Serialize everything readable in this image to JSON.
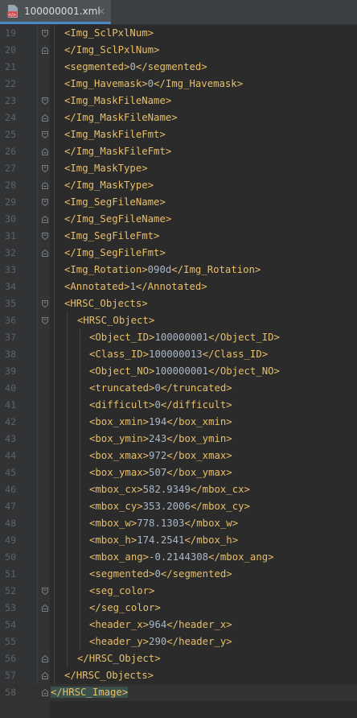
{
  "tab": {
    "filename": "100000001.xml",
    "close_glyph": "×",
    "icon": "xml-file-icon"
  },
  "lines": [
    {
      "no": "19",
      "indent": 1,
      "parts": [
        {
          "t": "<Img_SclPxlNum>",
          "k": "tag"
        }
      ],
      "fold": "open"
    },
    {
      "no": "20",
      "indent": 1,
      "parts": [
        {
          "t": "</Img_SclPxlNum>",
          "k": "tag"
        }
      ],
      "fold": "close"
    },
    {
      "no": "21",
      "indent": 1,
      "parts": [
        {
          "t": "<segmented>",
          "k": "tag"
        },
        {
          "t": "0",
          "k": "text"
        },
        {
          "t": "</segmented>",
          "k": "tag"
        }
      ]
    },
    {
      "no": "22",
      "indent": 1,
      "parts": [
        {
          "t": "<Img_Havemask>",
          "k": "tag"
        },
        {
          "t": "0",
          "k": "text"
        },
        {
          "t": "</Img_Havemask>",
          "k": "tag"
        }
      ]
    },
    {
      "no": "23",
      "indent": 1,
      "parts": [
        {
          "t": "<Img_MaskFileName>",
          "k": "tag"
        }
      ],
      "fold": "open"
    },
    {
      "no": "24",
      "indent": 1,
      "parts": [
        {
          "t": "</Img_MaskFileName>",
          "k": "tag"
        }
      ],
      "fold": "close"
    },
    {
      "no": "25",
      "indent": 1,
      "parts": [
        {
          "t": "<Img_MaskFileFmt>",
          "k": "tag"
        }
      ],
      "fold": "open"
    },
    {
      "no": "26",
      "indent": 1,
      "parts": [
        {
          "t": "</Img_MaskFileFmt>",
          "k": "tag"
        }
      ],
      "fold": "close"
    },
    {
      "no": "27",
      "indent": 1,
      "parts": [
        {
          "t": "<Img_MaskType>",
          "k": "tag"
        }
      ],
      "fold": "open"
    },
    {
      "no": "28",
      "indent": 1,
      "parts": [
        {
          "t": "</Img_MaskType>",
          "k": "tag"
        }
      ],
      "fold": "close"
    },
    {
      "no": "29",
      "indent": 1,
      "parts": [
        {
          "t": "<Img_SegFileName>",
          "k": "tag"
        }
      ],
      "fold": "open"
    },
    {
      "no": "30",
      "indent": 1,
      "parts": [
        {
          "t": "</Img_SegFileName>",
          "k": "tag"
        }
      ],
      "fold": "close"
    },
    {
      "no": "31",
      "indent": 1,
      "parts": [
        {
          "t": "<Img_SegFileFmt>",
          "k": "tag"
        }
      ],
      "fold": "open"
    },
    {
      "no": "32",
      "indent": 1,
      "parts": [
        {
          "t": "</Img_SegFileFmt>",
          "k": "tag"
        }
      ],
      "fold": "close"
    },
    {
      "no": "33",
      "indent": 1,
      "parts": [
        {
          "t": "<Img_Rotation>",
          "k": "tag"
        },
        {
          "t": "090d",
          "k": "text"
        },
        {
          "t": "</Img_Rotation>",
          "k": "tag"
        }
      ]
    },
    {
      "no": "34",
      "indent": 1,
      "parts": [
        {
          "t": "<Annotated>",
          "k": "tag"
        },
        {
          "t": "1",
          "k": "text"
        },
        {
          "t": "</Annotated>",
          "k": "tag"
        }
      ]
    },
    {
      "no": "35",
      "indent": 1,
      "parts": [
        {
          "t": "<HRSC_Objects>",
          "k": "tag"
        }
      ],
      "fold": "open"
    },
    {
      "no": "36",
      "indent": 2,
      "parts": [
        {
          "t": "<HRSC_Object>",
          "k": "tag"
        }
      ],
      "fold": "open"
    },
    {
      "no": "37",
      "indent": 3,
      "parts": [
        {
          "t": "<Object_ID>",
          "k": "tag"
        },
        {
          "t": "100000001",
          "k": "text"
        },
        {
          "t": "</Object_ID>",
          "k": "tag"
        }
      ]
    },
    {
      "no": "38",
      "indent": 3,
      "parts": [
        {
          "t": "<Class_ID>",
          "k": "tag"
        },
        {
          "t": "100000013",
          "k": "text"
        },
        {
          "t": "</Class_ID>",
          "k": "tag"
        }
      ]
    },
    {
      "no": "39",
      "indent": 3,
      "parts": [
        {
          "t": "<Object_NO>",
          "k": "tag"
        },
        {
          "t": "100000001",
          "k": "text"
        },
        {
          "t": "</Object_NO>",
          "k": "tag"
        }
      ]
    },
    {
      "no": "40",
      "indent": 3,
      "parts": [
        {
          "t": "<truncated>",
          "k": "tag"
        },
        {
          "t": "0",
          "k": "text"
        },
        {
          "t": "</truncated>",
          "k": "tag"
        }
      ]
    },
    {
      "no": "41",
      "indent": 3,
      "parts": [
        {
          "t": "<difficult>",
          "k": "tag"
        },
        {
          "t": "0",
          "k": "text"
        },
        {
          "t": "</difficult>",
          "k": "tag"
        }
      ]
    },
    {
      "no": "42",
      "indent": 3,
      "parts": [
        {
          "t": "<box_xmin>",
          "k": "tag"
        },
        {
          "t": "194",
          "k": "text"
        },
        {
          "t": "</box_xmin>",
          "k": "tag"
        }
      ]
    },
    {
      "no": "43",
      "indent": 3,
      "parts": [
        {
          "t": "<box_ymin>",
          "k": "tag"
        },
        {
          "t": "243",
          "k": "text"
        },
        {
          "t": "</box_ymin>",
          "k": "tag"
        }
      ]
    },
    {
      "no": "44",
      "indent": 3,
      "parts": [
        {
          "t": "<box_xmax>",
          "k": "tag"
        },
        {
          "t": "972",
          "k": "text"
        },
        {
          "t": "</box_xmax>",
          "k": "tag"
        }
      ]
    },
    {
      "no": "45",
      "indent": 3,
      "parts": [
        {
          "t": "<box_ymax>",
          "k": "tag"
        },
        {
          "t": "507",
          "k": "text"
        },
        {
          "t": "</box_ymax>",
          "k": "tag"
        }
      ]
    },
    {
      "no": "46",
      "indent": 3,
      "parts": [
        {
          "t": "<mbox_cx>",
          "k": "tag"
        },
        {
          "t": "582.9349",
          "k": "text"
        },
        {
          "t": "</mbox_cx>",
          "k": "tag"
        }
      ]
    },
    {
      "no": "47",
      "indent": 3,
      "parts": [
        {
          "t": "<mbox_cy>",
          "k": "tag"
        },
        {
          "t": "353.2006",
          "k": "text"
        },
        {
          "t": "</mbox_cy>",
          "k": "tag"
        }
      ]
    },
    {
      "no": "48",
      "indent": 3,
      "parts": [
        {
          "t": "<mbox_w>",
          "k": "tag"
        },
        {
          "t": "778.1303",
          "k": "text"
        },
        {
          "t": "</mbox_w>",
          "k": "tag"
        }
      ]
    },
    {
      "no": "49",
      "indent": 3,
      "parts": [
        {
          "t": "<mbox_h>",
          "k": "tag"
        },
        {
          "t": "174.2541",
          "k": "text"
        },
        {
          "t": "</mbox_h>",
          "k": "tag"
        }
      ]
    },
    {
      "no": "50",
      "indent": 3,
      "parts": [
        {
          "t": "<mbox_ang>",
          "k": "tag"
        },
        {
          "t": "-0.2144308",
          "k": "text"
        },
        {
          "t": "</mbox_ang>",
          "k": "tag"
        }
      ]
    },
    {
      "no": "51",
      "indent": 3,
      "parts": [
        {
          "t": "<segmented>",
          "k": "tag"
        },
        {
          "t": "0",
          "k": "text"
        },
        {
          "t": "</segmented>",
          "k": "tag"
        }
      ]
    },
    {
      "no": "52",
      "indent": 3,
      "parts": [
        {
          "t": "<seg_color>",
          "k": "tag"
        }
      ],
      "fold": "open"
    },
    {
      "no": "53",
      "indent": 3,
      "parts": [
        {
          "t": "</seg_color>",
          "k": "tag"
        }
      ],
      "fold": "close"
    },
    {
      "no": "54",
      "indent": 3,
      "parts": [
        {
          "t": "<header_x>",
          "k": "tag"
        },
        {
          "t": "964",
          "k": "text"
        },
        {
          "t": "</header_x>",
          "k": "tag"
        }
      ]
    },
    {
      "no": "55",
      "indent": 3,
      "parts": [
        {
          "t": "<header_y>",
          "k": "tag"
        },
        {
          "t": "290",
          "k": "text"
        },
        {
          "t": "</header_y>",
          "k": "tag"
        }
      ]
    },
    {
      "no": "56",
      "indent": 2,
      "parts": [
        {
          "t": "</HRSC_Object>",
          "k": "tag"
        }
      ],
      "fold": "close"
    },
    {
      "no": "57",
      "indent": 1,
      "parts": [
        {
          "t": "</HRSC_Objects>",
          "k": "tag"
        }
      ],
      "fold": "close"
    },
    {
      "no": "58",
      "indent": 0,
      "parts": [
        {
          "t": "</HRSC_Image>",
          "k": "tag-hl"
        }
      ],
      "fold": "close",
      "current": true
    }
  ],
  "colors": {
    "background": "#2b2b2b",
    "gutter": "#313335",
    "tag": "#e8bf6a",
    "text": "#a9b7c6",
    "line_number": "#606366",
    "matched_tag_highlight": "#3b514d",
    "tab_underline": "#4a88c7"
  }
}
